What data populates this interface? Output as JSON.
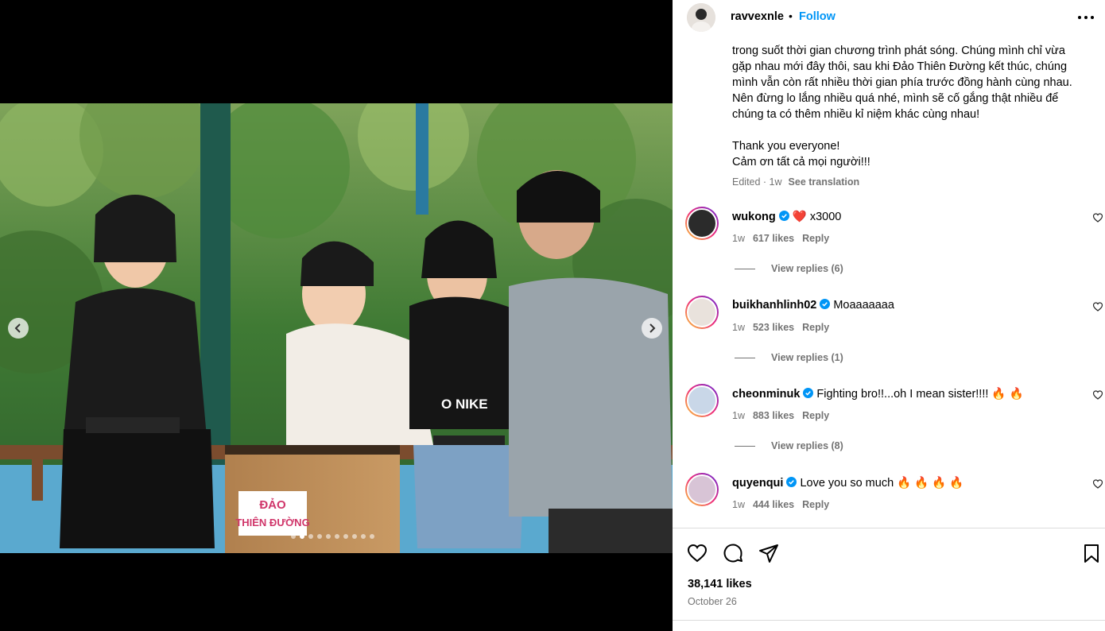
{
  "post": {
    "owner": "ravvexnle",
    "separator": "•",
    "follow_label": "Follow",
    "more_icon": "more-horizontal-icon"
  },
  "media": {
    "slide_count": 10,
    "active_slide": 2,
    "sign_text_line1": "ĐẢO",
    "sign_text_line2": "THIÊN ĐƯỜNG",
    "shirt_text": "O NIKE"
  },
  "caption": {
    "text": "trong suốt thời gian chương trình phát sóng. Chúng mình chỉ vừa gặp nhau mới đây thôi, sau khi Đảo Thiên Đường kết thúc, chúng mình vẫn còn rất nhiều thời gian phía trước đồng hành cùng nhau. Nên đừng lo lắng nhiều quá nhé, mình sẽ cố gắng thật nhiều để chúng ta có thêm nhiều kỉ niệm khác cùng nhau!\n\nThank you everyone!\nCảm ơn tất cả mọi người!!!",
    "meta": "Edited · 1w",
    "see_translation": "See translation"
  },
  "comments": [
    {
      "user": "wukong",
      "text": "❤️ x3000",
      "time": "1w",
      "likes": "617 likes",
      "reply": "Reply",
      "view_replies": "View replies (6)"
    },
    {
      "user": "buikhanhlinh02",
      "text": "Moaaaaaaa",
      "time": "1w",
      "likes": "523 likes",
      "reply": "Reply",
      "view_replies": "View replies (1)"
    },
    {
      "user": "cheonminuk",
      "text": "Fighting bro!!...oh I mean sister!!!! 🔥 🔥",
      "time": "1w",
      "likes": "883 likes",
      "reply": "Reply",
      "view_replies": "View replies (8)"
    },
    {
      "user": "quyenqui",
      "text": "Love you so much 🔥 🔥 🔥 🔥",
      "time": "1w",
      "likes": "444 likes",
      "reply": "Reply",
      "view_replies": ""
    }
  ],
  "footer": {
    "likes": "38,141 likes",
    "date": "October 26"
  },
  "colors": {
    "accent": "#0095f6",
    "muted": "#737373",
    "verified": "#0095f6"
  }
}
